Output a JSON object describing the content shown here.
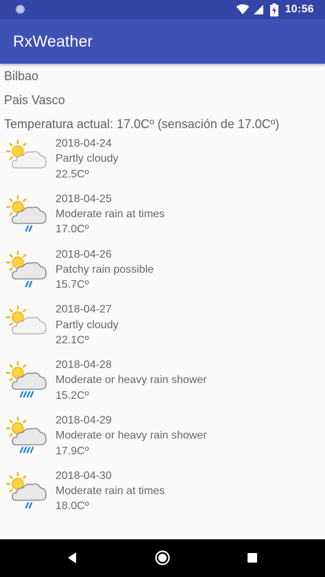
{
  "status_bar": {
    "time": "10:56",
    "icons": [
      "notification-dot-icon",
      "wifi-icon",
      "signal-icon",
      "battery-charging-icon"
    ]
  },
  "app_bar": {
    "title": "RxWeather",
    "color": "#3f51b5",
    "status_color": "#3445a6"
  },
  "location": {
    "city": "Bilbao",
    "region": "Pais Vasco",
    "current_temp": "Temperatura actual: 17.0Cº (sensación de 17.0Cº)"
  },
  "forecast": [
    {
      "date": "2018-04-24",
      "condition": "Partly cloudy",
      "temp": "22.5Cº",
      "icon": "partly-cloudy-icon"
    },
    {
      "date": "2018-04-25",
      "condition": "Moderate rain at times",
      "temp": "17.0Cº",
      "icon": "moderate-rain-icon"
    },
    {
      "date": "2018-04-26",
      "condition": "Patchy rain possible",
      "temp": "15.7Cº",
      "icon": "patchy-rain-icon"
    },
    {
      "date": "2018-04-27",
      "condition": "Partly cloudy",
      "temp": "22.1Cº",
      "icon": "partly-cloudy-icon"
    },
    {
      "date": "2018-04-28",
      "condition": "Moderate or heavy rain shower",
      "temp": "15.2Cº",
      "icon": "heavy-rain-shower-icon"
    },
    {
      "date": "2018-04-29",
      "condition": "Moderate or heavy rain shower",
      "temp": "17.9Cº",
      "icon": "heavy-rain-shower-icon"
    },
    {
      "date": "2018-04-30",
      "condition": "Moderate rain at times",
      "temp": "18.0Cº",
      "icon": "moderate-rain-icon"
    }
  ],
  "nav_bar": {
    "icons": [
      "back-icon",
      "home-icon",
      "recents-icon"
    ]
  }
}
